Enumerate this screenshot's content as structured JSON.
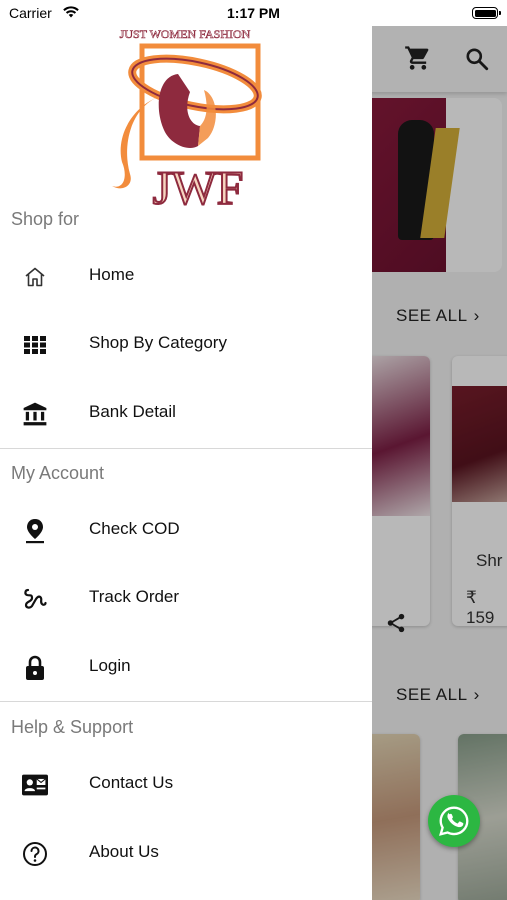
{
  "status_bar": {
    "carrier": "Carrier",
    "time": "1:17 PM"
  },
  "drawer": {
    "logo": {
      "tagline": "JUST WOMEN FASHION",
      "initials": "JWF"
    },
    "sections": [
      {
        "title": "Shop for",
        "items": [
          {
            "label": "Home",
            "icon": "home-icon"
          },
          {
            "label": "Shop By Category",
            "icon": "grid-icon"
          },
          {
            "label": "Bank Detail",
            "icon": "bank-icon"
          }
        ]
      },
      {
        "title": "My Account",
        "items": [
          {
            "label": "Check COD",
            "icon": "location-pin-icon"
          },
          {
            "label": "Track Order",
            "icon": "route-icon"
          },
          {
            "label": "Login",
            "icon": "lock-icon"
          }
        ]
      },
      {
        "title": "Help & Support",
        "items": [
          {
            "label": "Contact Us",
            "icon": "contact-card-icon"
          },
          {
            "label": "About Us",
            "icon": "help-circle-icon"
          }
        ]
      }
    ]
  },
  "background": {
    "see_all_label": "SEE ALL",
    "product_name_partial": "Shr",
    "product_price_partial": "₹ 159"
  },
  "colors": {
    "whatsapp": "#2cb742",
    "logo_orange": "#f28c3c",
    "logo_maroon": "#8e2a3e"
  }
}
